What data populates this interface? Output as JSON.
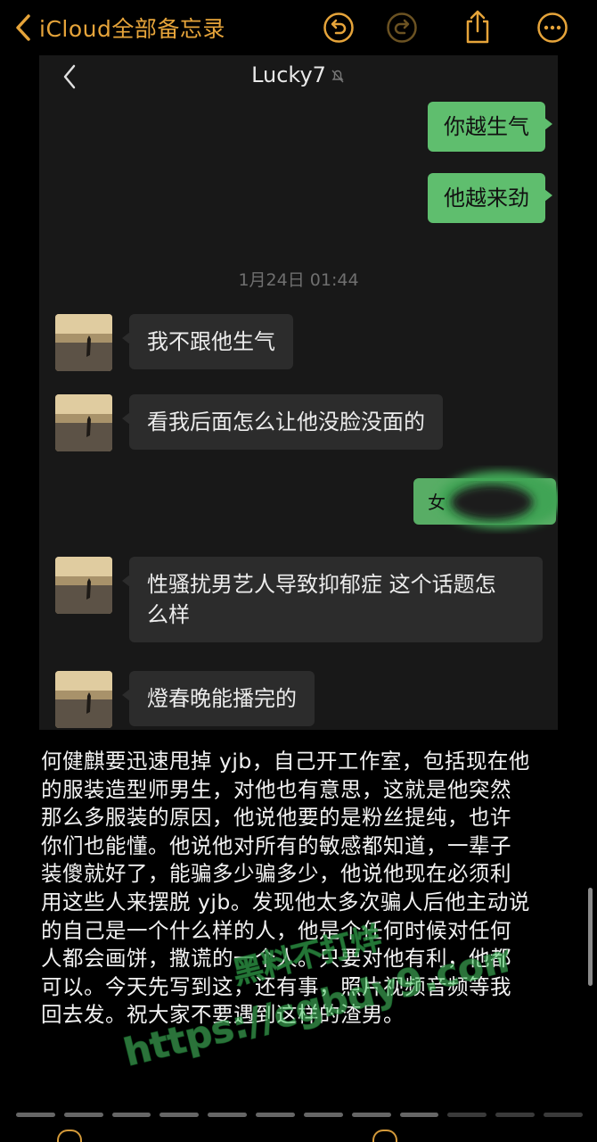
{
  "nav": {
    "back_label": "iCloud全部备忘录",
    "icons": [
      "chevron-left-icon",
      "undo-icon",
      "redo-icon",
      "share-icon",
      "more-icon"
    ],
    "accent": "#e6a43a"
  },
  "chat": {
    "title": "Lucky7",
    "timestamp": "1月24日 01:44",
    "messages": [
      {
        "side": "out",
        "text": "你越生气"
      },
      {
        "side": "out",
        "text": "他越来劲"
      },
      {
        "side": "in",
        "text": "我不跟他生气"
      },
      {
        "side": "in",
        "text": "看我后面怎么让他没脸没面的"
      },
      {
        "side": "out",
        "text": "女"
      },
      {
        "side": "in",
        "text_line1": "性骚扰男艺人导致抑郁症 这个话题怎",
        "text_line2": "么样"
      },
      {
        "side": "in",
        "text": "燈春晚能播完的"
      }
    ],
    "colors": {
      "outgoing": "#5fbe6e",
      "incoming": "#2c2c2c",
      "background": "#181818"
    }
  },
  "note": {
    "lines": [
      "何健麒要迅速甩掉 yjb，自己开工作室，包括现在他",
      "的服装造型师男生，对他也有意思，这就是他突然",
      "那么多服装的原因，他说他要的是粉丝提纯，也许",
      "你们也能懂。他说他对所有的敏感都知道，一辈子",
      "装傻就好了，能骗多少骗多少，他说他现在必须利",
      "用这些人来摆脱 yjb。发现他太多次骗人后他主动说",
      "的自己是一个什么样的人，他是个任何时候对任何",
      "人都会画饼，撒谎的一个人。只要对他有利，他都",
      "可以。今天先写到这，还有事，照片视频音频等我",
      "回去发。祝大家不要遇到这样的渣男。"
    ]
  },
  "watermark": {
    "line1": "黑料不打烊",
    "line2": "https://cgbdy9.com"
  }
}
